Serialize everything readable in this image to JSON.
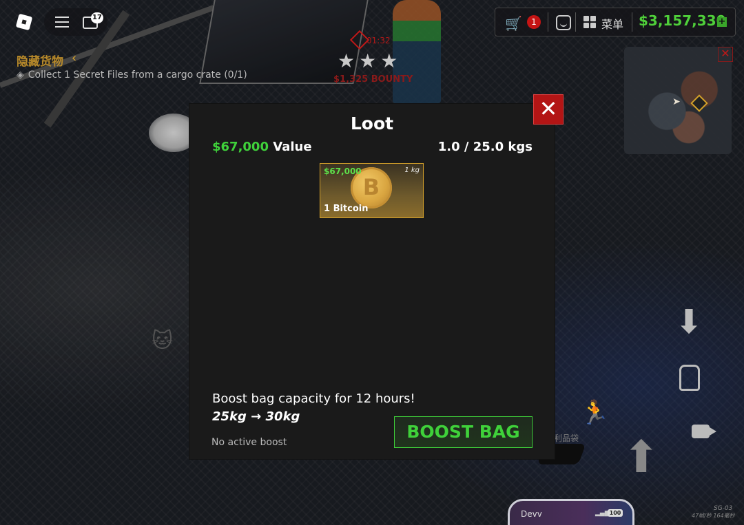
{
  "hud": {
    "chat_badge": "17",
    "basket_badge": "1",
    "menu_label": "菜单",
    "money": "$3,157,330",
    "money_plus": "+"
  },
  "quest": {
    "title": "隐藏货物",
    "objective": "Collect 1 Secret Files from a cargo crate (0/1)"
  },
  "wanted": {
    "timer": "01:32",
    "stars": "★★★",
    "bounty": "$1,325 BOUNTY"
  },
  "minimap": {
    "close_glyph": "✕"
  },
  "loot": {
    "title": "Loot",
    "value_amount": "$67,000",
    "value_label": "Value",
    "weight": "1.0 / 25.0 kgs",
    "close_glyph": "✕",
    "items": [
      {
        "price": "$67,000",
        "weight": "1 kg",
        "name": "1 Bitcoin",
        "icon": "bitcoin-coin-icon",
        "icon_glyph": "B"
      }
    ],
    "boost": {
      "text": "Boost bag capacity for 12 hours!",
      "change": "25kg → 30kg",
      "status": "No active boost",
      "button_label": "BOOST BAG"
    }
  },
  "controls": {
    "bag_label": "利品袋"
  },
  "phone": {
    "name": "Devv",
    "battery": "100"
  },
  "server": {
    "id": "SG-03",
    "stats": "47帧/秒 164毫秒"
  },
  "colors": {
    "accent_green": "#3fd13a",
    "close_red": "#b31515",
    "quest_gold": "#b88a2a",
    "item_border": "#d4a12a"
  }
}
